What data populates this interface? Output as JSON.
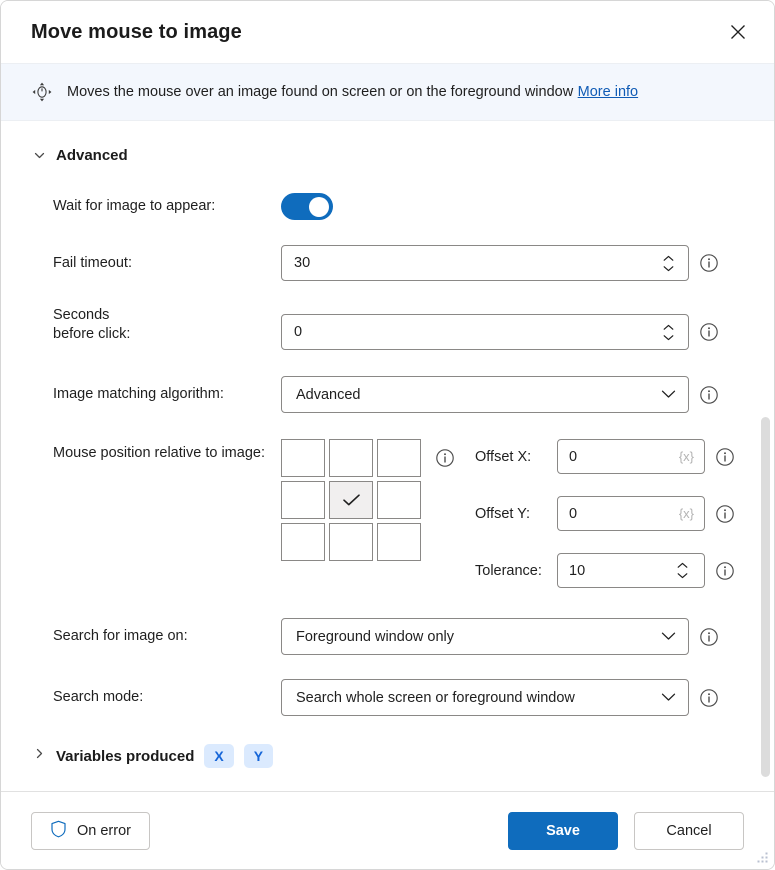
{
  "window": {
    "title": "Move mouse to image",
    "close_label": "✕"
  },
  "banner": {
    "icon": "move-mouse-icon",
    "text": "Moves the mouse over an image found on screen or on the foreground window",
    "link_label": "More info"
  },
  "advanced_section": {
    "title": "Advanced",
    "expanded": true
  },
  "fields": {
    "wait_for_image": {
      "label": "Wait for image to appear:",
      "toggle_on": true
    },
    "fail_timeout": {
      "label": "Fail timeout:",
      "value": "30"
    },
    "seconds_before_click": {
      "label_line1": "Seconds",
      "label_line2": "before click:",
      "value": "0"
    },
    "image_matching_algorithm": {
      "label": "Image matching algorithm:",
      "value": "Advanced"
    },
    "mouse_position": {
      "label": "Mouse position relative to image:",
      "selected_index": 4,
      "cells": [
        "top-left",
        "top-center",
        "top-right",
        "middle-left",
        "middle-center",
        "middle-right",
        "bottom-left",
        "bottom-center",
        "bottom-right"
      ]
    },
    "offset_x": {
      "label": "Offset X:",
      "value": "0",
      "var_hint": "{x}"
    },
    "offset_y": {
      "label": "Offset Y:",
      "value": "0",
      "var_hint": "{x}"
    },
    "tolerance": {
      "label": "Tolerance:",
      "value": "10"
    },
    "search_for_image_on": {
      "label": "Search for image on:",
      "value": "Foreground window only"
    },
    "search_mode": {
      "label": "Search mode:",
      "value": "Search whole screen or foreground window"
    }
  },
  "variables_produced": {
    "title": "Variables produced",
    "expanded": false,
    "badges": [
      "X",
      "Y"
    ]
  },
  "footer": {
    "on_error_label": "On error",
    "save_label": "Save",
    "cancel_label": "Cancel"
  },
  "colors": {
    "accent": "#0f6cbd",
    "link": "#0f5bb5",
    "banner_bg": "#f3f7fd",
    "badge_bg": "#dbeafe",
    "badge_text": "#1565d8",
    "border": "#8a8886"
  }
}
